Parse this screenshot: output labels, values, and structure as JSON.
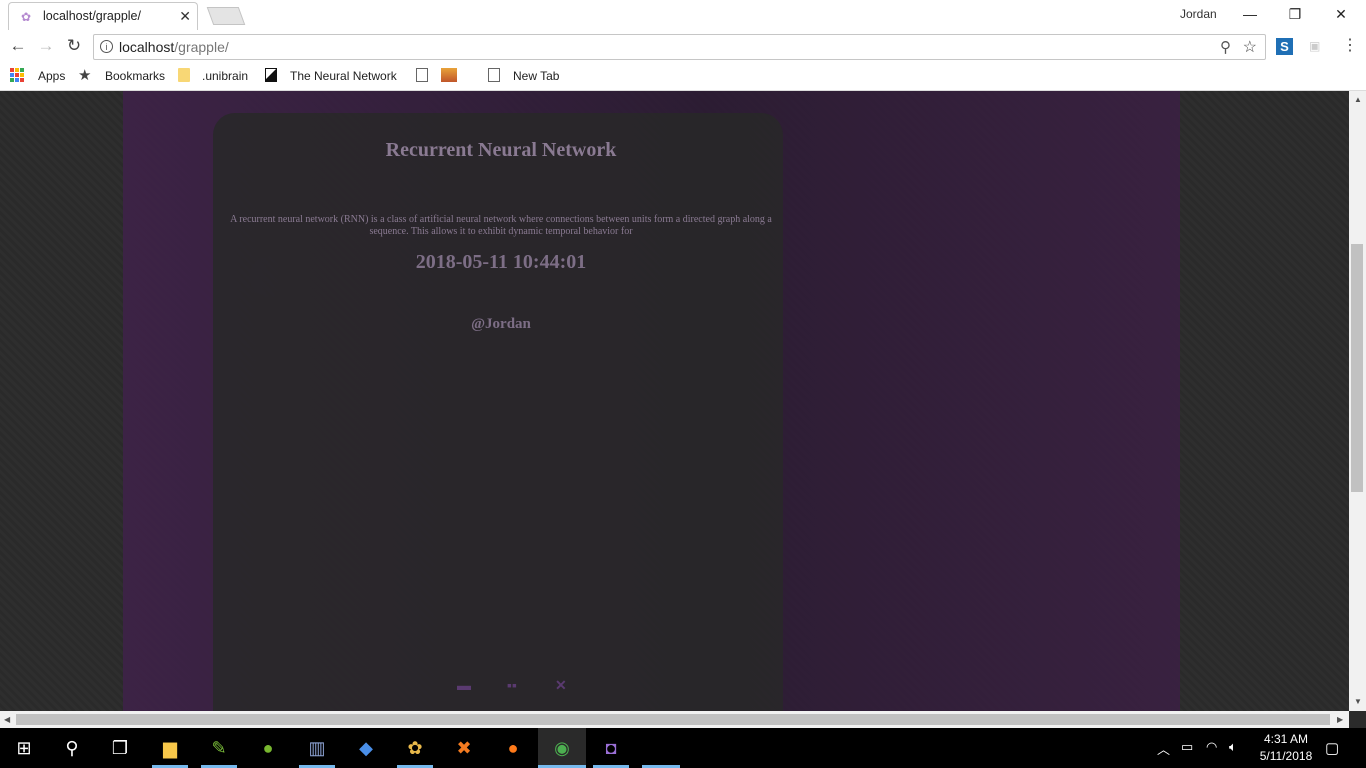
{
  "browser": {
    "tab_title": "localhost/grapple/",
    "profile_name": "Jordan",
    "url_host": "localhost",
    "url_path": "/grapple/",
    "bookmarks": [
      "Apps",
      "Bookmarks",
      ".unibrain",
      "The Neural Network",
      "New Tab"
    ]
  },
  "page": {
    "title": "Recurrent Neural Network",
    "description": "A recurrent neural network (RNN) is a class of artificial neural network where connections between units form a directed graph along a sequence. This allows it to exhibit dynamic temporal behavior for",
    "timestamp": "2018-05-11 10:44:01",
    "author": "@Jordan",
    "accent_color": "#8a7a92"
  },
  "taskbar": {
    "time": "4:31 AM",
    "date": "5/11/2018"
  }
}
